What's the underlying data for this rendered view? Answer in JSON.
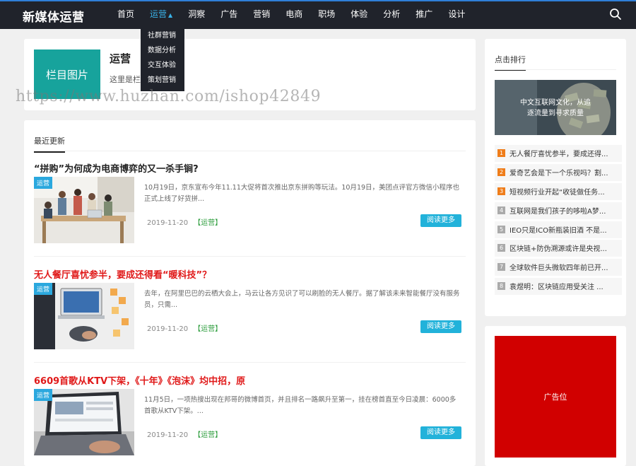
{
  "header": {
    "logo": "新媒体运营",
    "nav": [
      "首页",
      "运营",
      "洞察",
      "广告",
      "营销",
      "电商",
      "职场",
      "体验",
      "分析",
      "推广",
      "设计"
    ],
    "active_index": 1,
    "dropdown": [
      "社群营销",
      "数据分析",
      "交互体验",
      "策划营销"
    ]
  },
  "banner": {
    "image_label": "栏目图片",
    "title": "运营",
    "desc": "这里是栏"
  },
  "watermark": "https://www.huzhan.com/ishop42849",
  "list": {
    "heading": "最近更新",
    "read_more": "阅读更多",
    "posts": [
      {
        "title": "“拼购”为何成为电商博弈的又一杀手锏?",
        "tag": "运营",
        "excerpt": "10月19日，京东宣布今年11.11大促将首次推出京东拼购等玩法。10月19日，美团点评官方微信小程序也正式上线了好货拼...",
        "date": "2019-11-20",
        "category": "【运营】",
        "title_red": false
      },
      {
        "title": "无人餐厅喜忧参半，要成还得看“暖科技”？",
        "tag": "运营",
        "excerpt": "去年，在阿里巴巴的云栖大会上，马云让各方见识了可以刷脸的无人餐厅。据了解该未来智能餐厅没有服务员，只需...",
        "date": "2019-11-20",
        "category": "【运营】",
        "title_red": true
      },
      {
        "title": "6609首歌从KTV下架，《十年》《泡沫》均中招，原",
        "tag": "运营",
        "excerpt": "11月5日，一项热搜出现在邦哥的微博首页，并且排名一路飙升至第一，挂在榜首直至今日凌晨：6000多首歌从KTV下架。...",
        "date": "2019-11-20",
        "category": "【运营】",
        "title_red": true
      }
    ]
  },
  "sidebar": {
    "heading": "点击排行",
    "pic_text_1": "中文互联网文化，从追",
    "pic_text_2": "逐流量到寻求质量",
    "items": [
      {
        "num": "1",
        "text": "无人餐厅喜忧参半，要成还得..."
      },
      {
        "num": "2",
        "text": "爱奇艺会是下一个乐视吗？割..."
      },
      {
        "num": "3",
        "text": "短视频行业开起“收徒做任务..."
      },
      {
        "num": "4",
        "text": "互联网是我们孩子的哆啦A梦..."
      },
      {
        "num": "5",
        "text": "IEO只是ICO新瓶装旧酒 不是..."
      },
      {
        "num": "6",
        "text": "区块链+防伪溯源或许是央视..."
      },
      {
        "num": "7",
        "text": "全球软件巨头微软四年前已开..."
      },
      {
        "num": "8",
        "text": "袁煜明：区块链应用受关注 ..."
      }
    ],
    "ad_label": "广告位"
  }
}
